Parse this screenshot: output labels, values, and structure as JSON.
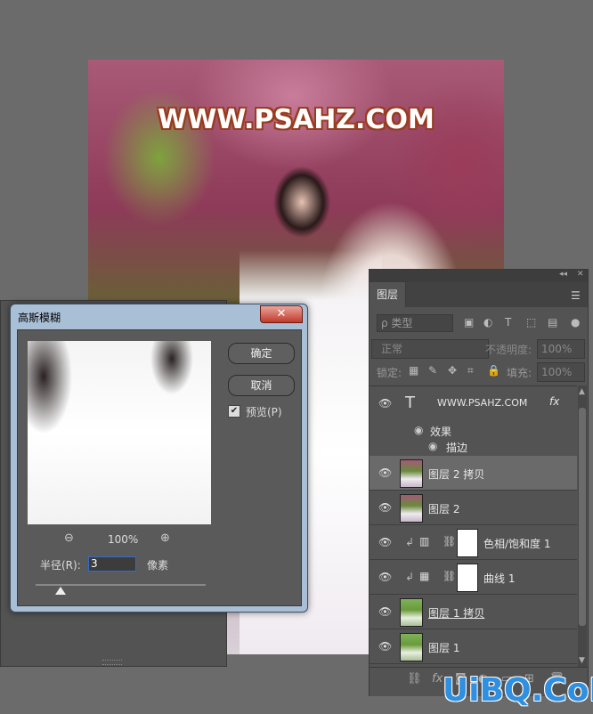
{
  "canvas": {
    "watermark": "WWW.PSAHZ.COM"
  },
  "dialog": {
    "title": "高斯模糊",
    "close": "✕",
    "ok": "确定",
    "cancel": "取消",
    "preview_label": "预览(P)",
    "preview_checked": true,
    "zoom": "100%",
    "radius_label": "半径(R):",
    "radius_value": "3",
    "radius_unit": "像素",
    "radius_slider_fraction": 0.12
  },
  "layers_panel": {
    "tab": "图层",
    "filter": "ρ 类型",
    "blend_mode": "正常",
    "opacity_label": "不透明度:",
    "opacity_value": "100%",
    "lock_label": "锁定:",
    "fill_label": "填充:",
    "fill_value": "100%",
    "effects_label": "效果",
    "stroke_label": "描边",
    "layers": [
      {
        "name": "WWW.PSAHZ.COM",
        "type": "text",
        "fx": "fx"
      },
      {
        "name": "图层 2 拷贝",
        "type": "image",
        "selected": true
      },
      {
        "name": "图层 2",
        "type": "image"
      },
      {
        "name": "色相/饱和度 1",
        "type": "adjustment-hue"
      },
      {
        "name": "曲线 1",
        "type": "adjustment-curves"
      },
      {
        "name": "图层 1 拷贝",
        "type": "image-green"
      },
      {
        "name": "图层 1",
        "type": "image-green"
      }
    ]
  },
  "brand": "UiBQ.CoM"
}
